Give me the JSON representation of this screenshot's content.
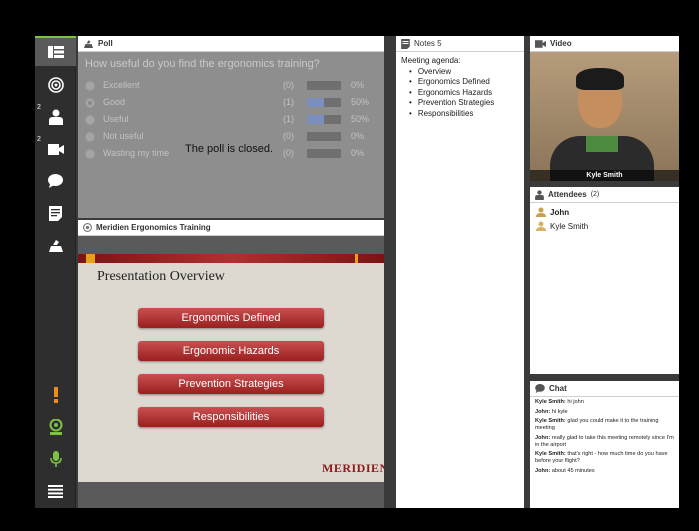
{
  "toolbar": {
    "items": [
      {
        "icon": "presentation-icon",
        "badge": ""
      },
      {
        "icon": "target-icon",
        "badge": ""
      },
      {
        "icon": "user-icon",
        "badge": "2"
      },
      {
        "icon": "camera-icon",
        "badge": "2"
      },
      {
        "icon": "chat-bubble-icon",
        "badge": ""
      },
      {
        "icon": "notes-icon",
        "badge": ""
      },
      {
        "icon": "poll-icon",
        "badge": ""
      }
    ],
    "bottom": [
      {
        "icon": "alert-icon"
      },
      {
        "icon": "webcam-icon"
      },
      {
        "icon": "microphone-icon"
      },
      {
        "icon": "menu-icon"
      }
    ]
  },
  "poll": {
    "title": "Poll",
    "question": "How useful do you find the ergonomics training?",
    "options": [
      {
        "label": "Excellent",
        "count": "(0)",
        "pct": "0%",
        "fraction": 0,
        "selected": false
      },
      {
        "label": "Good",
        "count": "(1)",
        "pct": "50%",
        "fraction": 0.5,
        "selected": true
      },
      {
        "label": "Useful",
        "count": "(1)",
        "pct": "50%",
        "fraction": 0.5,
        "selected": false
      },
      {
        "label": "Not useful",
        "count": "(0)",
        "pct": "0%",
        "fraction": 0,
        "selected": false
      },
      {
        "label": "Wasting my time",
        "count": "(0)",
        "pct": "0%",
        "fraction": 0,
        "selected": false
      }
    ],
    "closed_message": "The poll is closed."
  },
  "presentation": {
    "title": "Meridien Ergonomics Training",
    "slide_title": "Presentation Overview",
    "buttons": [
      "Ergonomics Defined",
      "Ergonomic Hazards",
      "Prevention Strategies",
      "Responsibilities"
    ],
    "logo": "MERIDIEN"
  },
  "notes": {
    "title": "Notes 5",
    "heading": "Meeting agenda:",
    "items": [
      "Overview",
      "Ergonomics Defined",
      "Ergonomics Hazards",
      "Prevention Strategies",
      "Responsibilities"
    ]
  },
  "video": {
    "title": "Video",
    "name": "Kyle Smith"
  },
  "attendees": {
    "title": "Attendees",
    "count": "(2)",
    "list": [
      {
        "name": "John",
        "me": true
      },
      {
        "name": "Kyle Smith",
        "me": false
      }
    ]
  },
  "chat": {
    "title": "Chat",
    "messages": [
      {
        "from": "Kyle Smith:",
        "text": " hi john"
      },
      {
        "from": "John:",
        "text": " hi kyle"
      },
      {
        "from": "Kyle Smith:",
        "text": " glad you could make it to the training meeting"
      },
      {
        "from": "John:",
        "text": " really glad to take this meeting remotely since I'm in the airport"
      },
      {
        "from": "Kyle Smith:",
        "text": " that's right - how much time do you have before your flight?"
      },
      {
        "from": "John:",
        "text": " about 45 minutes"
      }
    ]
  },
  "colors": {
    "accent": "#7dc242",
    "brand_red": "#9a2020",
    "poll_bar": "#7b8fbf"
  }
}
